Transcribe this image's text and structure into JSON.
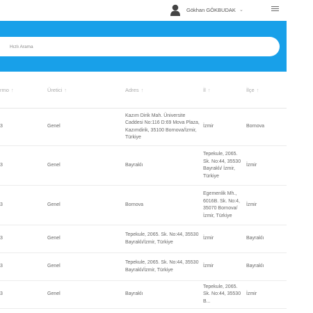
{
  "header": {
    "user_name": "Gökhan GÖKBUDAK",
    "dropdown_glyph": "⌄",
    "avatar_icon": "user-avatar-icon",
    "menu_icon": "hamburger-menu-icon"
  },
  "search": {
    "placeholder": "Hızlı Arama"
  },
  "table": {
    "columns": [
      {
        "label": "rmo",
        "sort_glyph": "↑"
      },
      {
        "label": "Üretici",
        "sort_glyph": "↑"
      },
      {
        "label": "Adres",
        "sort_glyph": "↑"
      },
      {
        "label": "İl",
        "sort_glyph": "↑"
      },
      {
        "label": "İlçe",
        "sort_glyph": "↑"
      }
    ],
    "rows": [
      {
        "no": "3",
        "uretici": "Genel",
        "adres": "Kazım Dirik Mah. Üniversite Caddesi No:116 D:69 Mova Plaza, Kazımdirik, 35100 Bornova/İzmir, Türkiye",
        "il": "İzmir",
        "ilce": "Bornova"
      },
      {
        "no": "3",
        "uretici": "Genel",
        "adres": "Bayraklı",
        "il": "Tepekule, 2065. Sk. No:44, 35530 Bayraklı/ İzmir, Türkiye",
        "ilce": "İzmir"
      },
      {
        "no": "3",
        "uretici": "Genel",
        "adres": "Bornova",
        "il": "Egemenlik Mh., 6016B. Sk. No:4, 35070 Bornova/ İzmir, Türkiye",
        "ilce": "İzmir"
      },
      {
        "no": "3",
        "uretici": "Genel",
        "adres": "Tepekule, 2065. Sk. No:44, 35530 Bayraklı/İzmir, Türkiye",
        "il": "İzmir",
        "ilce": "Bayraklı"
      },
      {
        "no": "3",
        "uretici": "Genel",
        "adres": "Tepekule, 2065. Sk. No:44, 35530 Bayraklı/İzmir, Türkiye",
        "il": "İzmir",
        "ilce": "Bayraklı"
      },
      {
        "no": "3",
        "uretici": "Genel",
        "adres": "Bayraklı",
        "il": "Tepekule, 2065. Sk. No:44, 35530 B...",
        "ilce": "İzmir"
      }
    ]
  },
  "colors": {
    "accent": "#18a0e9"
  }
}
